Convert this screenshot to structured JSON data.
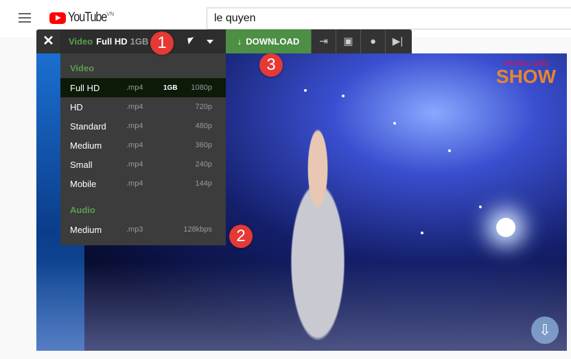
{
  "header": {
    "logo": "YouTube",
    "region": "VN",
    "search_value": "le quyen"
  },
  "toolbar": {
    "close": "✕",
    "type_label": "Video",
    "quality": "Full HD",
    "size": "1GB",
    "download": "DOWNLOAD",
    "download_icon": "↓",
    "icons": [
      "phone-export-icon",
      "picture-in-picture-icon",
      "lightbulb-icon",
      "skip-next-icon"
    ]
  },
  "dropdown": {
    "video_header": "Video",
    "video": [
      {
        "name": "Full HD",
        "format": ".mp4",
        "size": "1GB",
        "quality": "1080p"
      },
      {
        "name": "HD",
        "format": ".mp4",
        "size": "",
        "quality": "720p"
      },
      {
        "name": "Standard",
        "format": ".mp4",
        "size": "",
        "quality": "480p"
      },
      {
        "name": "Medium",
        "format": ".mp4",
        "size": "",
        "quality": "360p"
      },
      {
        "name": "Small",
        "format": ".mp4",
        "size": "",
        "quality": "240p"
      },
      {
        "name": "Mobile",
        "format": ".mp4",
        "size": "",
        "quality": "144p"
      }
    ],
    "audio_header": "Audio",
    "audio": [
      {
        "name": "Medium",
        "format": ".mp3",
        "quality": "128kbps"
      }
    ]
  },
  "video": {
    "watermark_top": "THANG LONG",
    "watermark_main": "SHOW"
  },
  "badges": [
    "1",
    "2",
    "3"
  ],
  "colors": {
    "accent_green": "#4c8f45",
    "badge_red": "#e53935"
  }
}
